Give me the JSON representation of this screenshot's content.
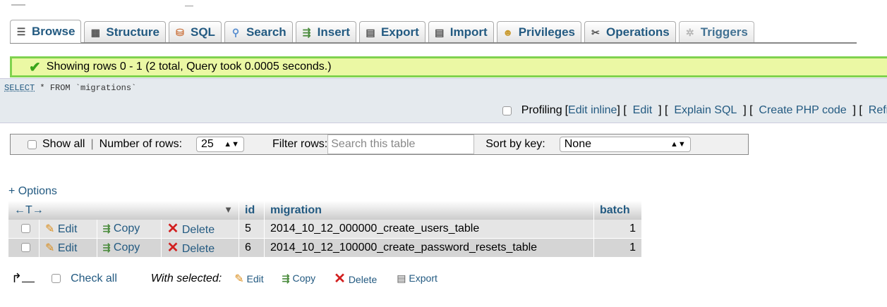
{
  "tabs": [
    {
      "label": "Browse",
      "icon": "browse-icon"
    },
    {
      "label": "Structure",
      "icon": "structure-icon"
    },
    {
      "label": "SQL",
      "icon": "sql-icon"
    },
    {
      "label": "Search",
      "icon": "search-icon"
    },
    {
      "label": "Insert",
      "icon": "insert-icon"
    },
    {
      "label": "Export",
      "icon": "export-icon"
    },
    {
      "label": "Import",
      "icon": "import-icon"
    },
    {
      "label": "Privileges",
      "icon": "privileges-icon"
    },
    {
      "label": "Operations",
      "icon": "operations-icon"
    },
    {
      "label": "Triggers",
      "icon": "triggers-icon"
    }
  ],
  "status": {
    "message": "Showing rows 0 - 1 (2 total, Query took 0.0005 seconds.)"
  },
  "query": {
    "select": "SELECT",
    "rest": " * FROM `migrations`",
    "profiling_label": "Profiling",
    "edit_inline": "Edit inline",
    "edit": "Edit",
    "explain": "Explain SQL",
    "create_php": "Create PHP code",
    "refresh": "Refr"
  },
  "navbar": {
    "show_all": "Show all",
    "separator": "|",
    "rows_label": "Number of rows:",
    "rows_value": "25",
    "filter_label": "Filter rows:",
    "filter_placeholder": "Search this table",
    "sort_label": "Sort by key:",
    "sort_value": "None"
  },
  "options_link": "+ Options",
  "table": {
    "arrows": "←T→",
    "columns": [
      "id",
      "migration",
      "batch"
    ],
    "row_actions": {
      "edit": "Edit",
      "copy": "Copy",
      "delete": "Delete"
    },
    "rows": [
      {
        "id": "5",
        "migration": "2014_10_12_000000_create_users_table",
        "batch": "1"
      },
      {
        "id": "6",
        "migration": "2014_10_12_100000_create_password_resets_table",
        "batch": "1"
      }
    ]
  },
  "bottom": {
    "check_all": "Check all",
    "with_selected": "With selected:",
    "edit": "Edit",
    "copy": "Copy",
    "delete": "Delete",
    "export": "Export"
  },
  "colors": {
    "link": "#235a81",
    "success_bg": "#ebf8a4",
    "success_border": "#7fd24f"
  }
}
